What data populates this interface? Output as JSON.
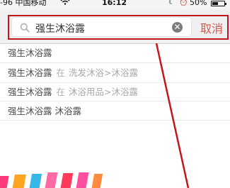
{
  "status_bar": {
    "carrier": "-96 中国移动",
    "time": "16:12",
    "battery": "50%",
    "battery_level": 0.5
  },
  "search": {
    "query": "强生沐浴露",
    "clear_symbol": "✕",
    "cancel_label": "取消"
  },
  "suggestions": [
    {
      "keyword": "强生沐浴露"
    },
    {
      "keyword": "强生沐浴露",
      "in_word": "在",
      "category": "洗发沐浴>沐浴露"
    },
    {
      "keyword": "强生沐浴露",
      "in_word": "在",
      "category": "沐浴用品>沐浴露"
    },
    {
      "keyword": "强生沐浴露 沐浴露"
    }
  ],
  "colors": {
    "accent_cancel": "#d8564c",
    "annotation_red": "#c4161c"
  }
}
